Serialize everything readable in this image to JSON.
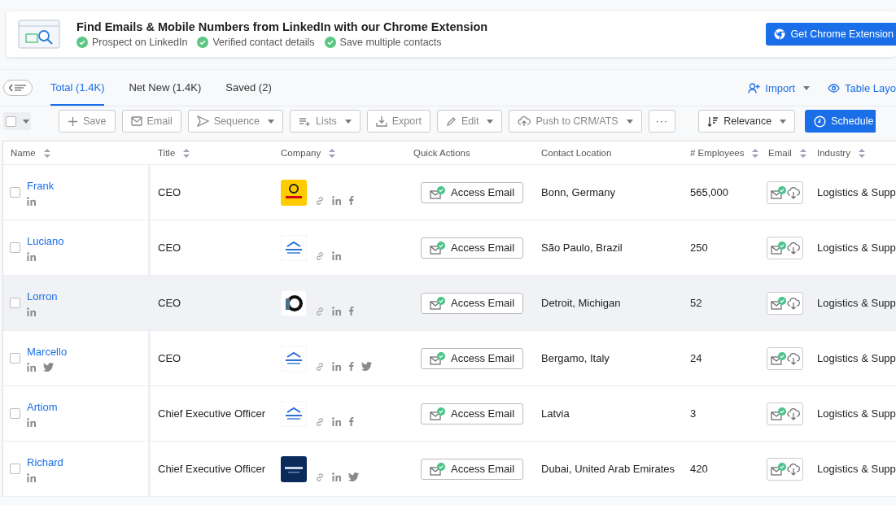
{
  "banner": {
    "title": "Find Emails & Mobile Numbers from LinkedIn with our Chrome Extension",
    "features": [
      "Prospect on LinkedIn",
      "Verified contact details",
      "Save multiple contacts"
    ],
    "button": "Get Chrome Extension"
  },
  "tabs": [
    {
      "label": "Total (1.4K)",
      "selected": true
    },
    {
      "label": "Net New (1.4K)",
      "selected": false
    },
    {
      "label": "Saved (2)",
      "selected": false
    }
  ],
  "top_actions": [
    {
      "kind": "import",
      "label": "Import"
    },
    {
      "kind": "layout",
      "label": "Table Layo"
    }
  ],
  "select_all": {
    "checked": false
  },
  "toolbar": [
    {
      "kind": "save",
      "label": "Save",
      "disabled": true,
      "dropdown": false
    },
    {
      "kind": "email",
      "label": "Email",
      "disabled": true,
      "dropdown": false
    },
    {
      "kind": "sequence",
      "label": "Sequence",
      "disabled": true,
      "dropdown": true
    },
    {
      "kind": "lists",
      "label": "Lists",
      "disabled": true,
      "dropdown": true
    },
    {
      "kind": "export",
      "label": "Export",
      "disabled": true,
      "dropdown": false
    },
    {
      "kind": "edit",
      "label": "Edit",
      "disabled": true,
      "dropdown": true
    },
    {
      "kind": "push",
      "label": "Push to CRM/ATS",
      "disabled": true,
      "dropdown": true
    },
    {
      "kind": "more",
      "label": "···",
      "disabled": false,
      "dropdown": false
    },
    {
      "kind": "sort",
      "label": "Relevance",
      "disabled": false,
      "dropdown": true
    },
    {
      "kind": "schedule",
      "label": "Schedule",
      "disabled": false,
      "dropdown": false
    }
  ],
  "table": {
    "columns": [
      {
        "label": "Name",
        "sortable": true
      },
      {
        "label": "Title",
        "sortable": true
      },
      {
        "label": "Company",
        "sortable": true
      },
      {
        "label": "Quick Actions",
        "sortable": false
      },
      {
        "label": "Contact Location",
        "sortable": false
      },
      {
        "label": "# Employees",
        "sortable": true
      },
      {
        "label": "Email",
        "sortable": true
      },
      {
        "label": "Industry",
        "sortable": true
      }
    ],
    "rows": [
      {
        "name": "Frank",
        "checked": false,
        "hovered": false,
        "person_socials": [
          {
            "kind": "linkedin"
          }
        ],
        "title": "CEO",
        "logo": {
          "kind": "yellow"
        },
        "company_socials": [
          {
            "kind": "link"
          },
          {
            "kind": "linkedin"
          },
          {
            "kind": "facebook"
          }
        ],
        "action": "Access Email",
        "location": "Bonn, Germany",
        "employees": "565,000",
        "industry": "Logistics & Supp"
      },
      {
        "name": "Luciano",
        "checked": false,
        "hovered": false,
        "person_socials": [
          {
            "kind": "linkedin"
          }
        ],
        "title": "CEO",
        "logo": {
          "kind": "light"
        },
        "company_socials": [
          {
            "kind": "link"
          },
          {
            "kind": "linkedin"
          }
        ],
        "action": "Access Email",
        "location": "São Paulo, Brazil",
        "employees": "250",
        "industry": "Logistics & Supp"
      },
      {
        "name": "Lorron",
        "checked": false,
        "hovered": true,
        "person_socials": [
          {
            "kind": "linkedin"
          }
        ],
        "title": "CEO",
        "logo": {
          "kind": "mono"
        },
        "company_socials": [
          {
            "kind": "link"
          },
          {
            "kind": "linkedin"
          },
          {
            "kind": "facebook"
          }
        ],
        "action": "Access Email",
        "location": "Detroit, Michigan",
        "employees": "52",
        "industry": "Logistics & Supp"
      },
      {
        "name": "Marcello",
        "checked": false,
        "hovered": false,
        "person_socials": [
          {
            "kind": "linkedin"
          },
          {
            "kind": "twitter"
          }
        ],
        "title": "CEO",
        "logo": {
          "kind": "light"
        },
        "company_socials": [
          {
            "kind": "link"
          },
          {
            "kind": "linkedin"
          },
          {
            "kind": "facebook"
          },
          {
            "kind": "twitter"
          }
        ],
        "action": "Access Email",
        "location": "Bergamo, Italy",
        "employees": "24",
        "industry": "Logistics & Supp"
      },
      {
        "name": "Artiom",
        "checked": false,
        "hovered": false,
        "person_socials": [
          {
            "kind": "linkedin"
          }
        ],
        "title": "Chief Executive Officer",
        "logo": {
          "kind": "light"
        },
        "company_socials": [
          {
            "kind": "link"
          },
          {
            "kind": "linkedin"
          },
          {
            "kind": "facebook"
          }
        ],
        "action": "Access Email",
        "location": "Latvia",
        "employees": "3",
        "industry": "Logistics & Supp"
      },
      {
        "name": "Richard",
        "checked": false,
        "hovered": false,
        "person_socials": [
          {
            "kind": "linkedin"
          }
        ],
        "title": "Chief Executive Officer",
        "logo": {
          "kind": "navy"
        },
        "company_socials": [
          {
            "kind": "link"
          },
          {
            "kind": "linkedin"
          },
          {
            "kind": "twitter"
          }
        ],
        "action": "Access Email",
        "location": "Dubai, United Arab Emirates",
        "employees": "420",
        "industry": "Logistics & Supp"
      }
    ]
  }
}
